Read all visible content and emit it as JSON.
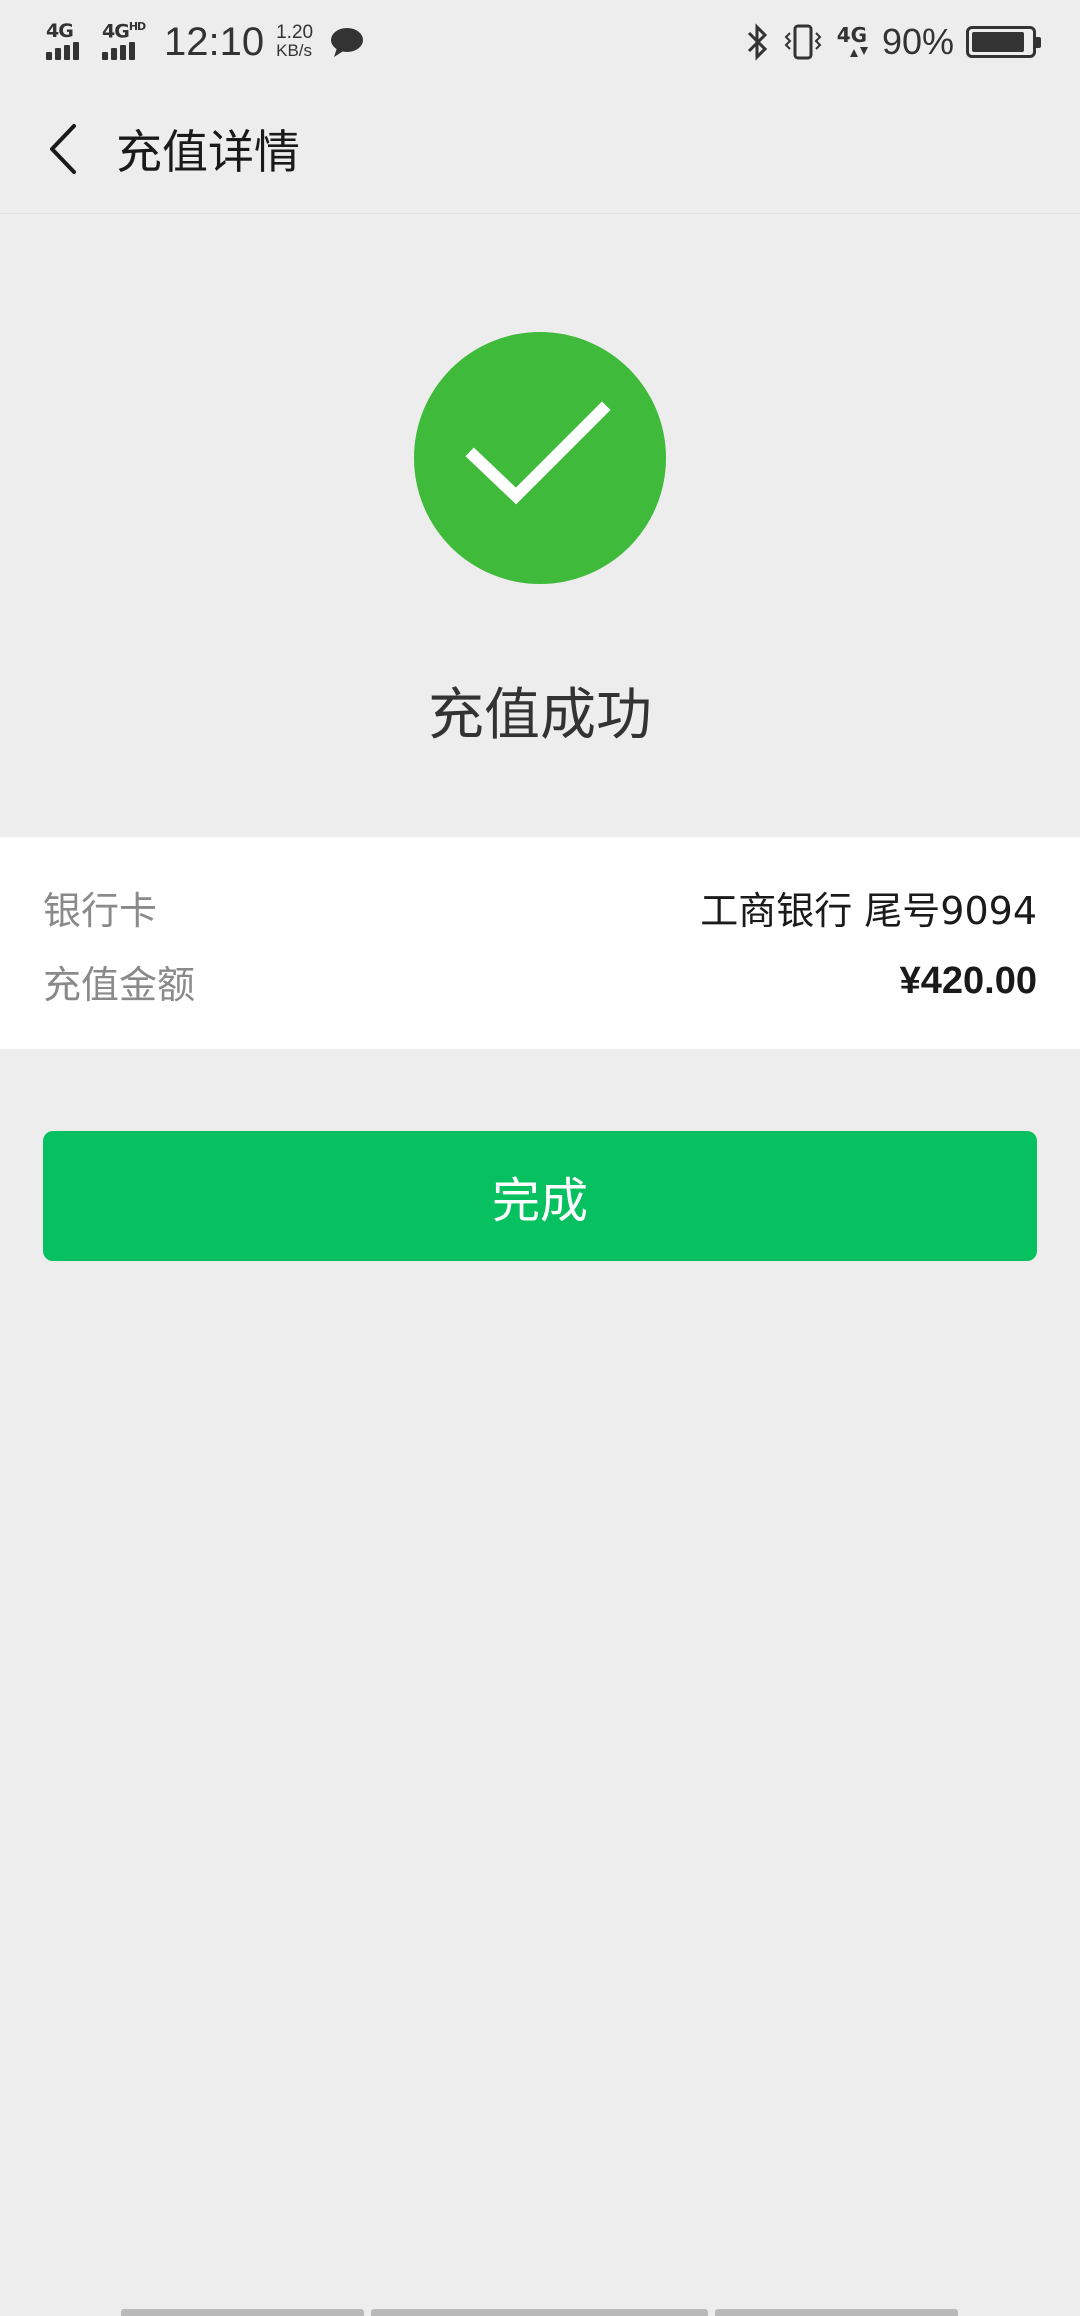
{
  "status_bar": {
    "network_1": "4G",
    "network_2": "4G",
    "network_2_suffix": "HD",
    "time": "12:10",
    "speed_value": "1.20",
    "speed_unit": "KB/s",
    "data_network": "4G",
    "battery_percent": "90%",
    "battery_level": 0.9,
    "icons": [
      "signal-icon",
      "chat-bubble-icon",
      "bluetooth-icon",
      "vibrate-icon",
      "data-arrows-icon",
      "battery-icon"
    ]
  },
  "nav": {
    "back_icon": "chevron-left-icon",
    "title": "充值详情"
  },
  "result": {
    "icon": "check-circle-icon",
    "icon_color": "#3fba3a",
    "title": "充值成功"
  },
  "details": [
    {
      "label": "银行卡",
      "value": "工商银行 尾号9094"
    },
    {
      "label": "充值金额",
      "value": "¥420.00"
    }
  ],
  "actions": {
    "done_label": "完成",
    "done_color": "#07c160"
  }
}
